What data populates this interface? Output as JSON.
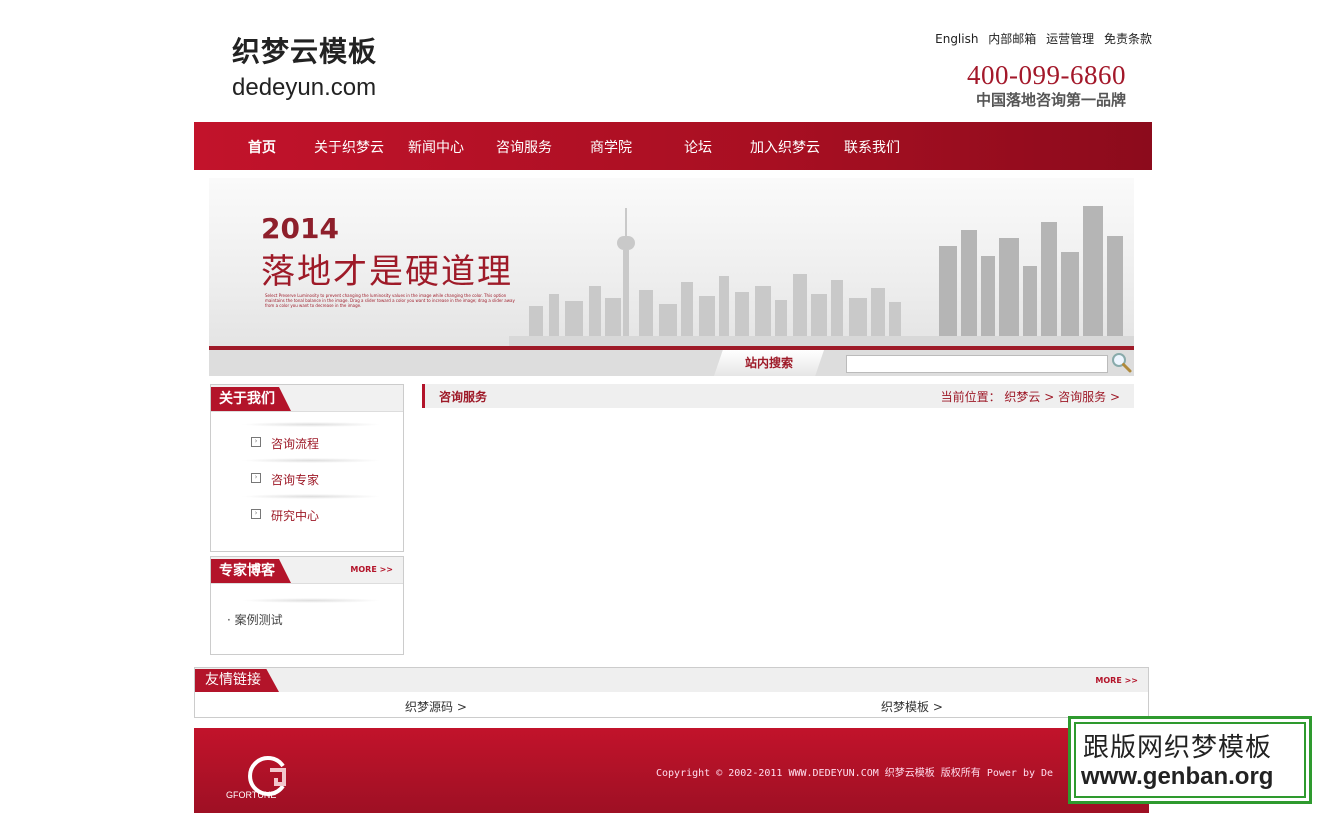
{
  "header": {
    "logo_cn": "织梦云模板",
    "logo_en": "dedeyun.com",
    "top_links": [
      "English",
      "内部邮箱",
      "运营管理",
      "免责条款"
    ],
    "hotline": "400-099-6860",
    "slogan": "中国落地咨询第一品牌"
  },
  "nav": {
    "items": [
      "首页",
      "关于织梦云",
      "新闻中心",
      "咨询服务",
      "商学院",
      "论坛",
      "加入织梦云",
      "联系我们"
    ]
  },
  "banner": {
    "year": "2014",
    "motto": "落地才是硬道理",
    "small_text": "Select Preserve Luminosity to prevent changing the luminosity values in the image while changing the color. This option maintains the tonal balance in the image. Drag a slider toward a color you want to increase in the image; drag a slider away from a color you want to decrease in the image."
  },
  "search": {
    "label": "站内搜索",
    "value": ""
  },
  "sidebar": {
    "about": {
      "title": "关于我们",
      "items": [
        "咨询流程",
        "咨询专家",
        "研究中心"
      ]
    },
    "blog": {
      "title": "专家博客",
      "more": "MORE >>",
      "items": [
        "· 案例测试"
      ]
    }
  },
  "main": {
    "title": "咨询服务",
    "location_label": "当前位置：",
    "crumbs": [
      "织梦云 >",
      "咨询服务 >"
    ]
  },
  "links": {
    "title": "友情链接",
    "more": "MORE >>",
    "items": [
      "织梦源码 >",
      "织梦模板 >"
    ]
  },
  "footer": {
    "logo_text": "GFORTUNE",
    "copyright": "Copyright © 2002-2011 WWW.DEDEYUN.COM 织梦云模板 版权所有 Power by De"
  },
  "watermark": {
    "line1": "跟版网织梦模板",
    "line2": "www.genban.org"
  }
}
